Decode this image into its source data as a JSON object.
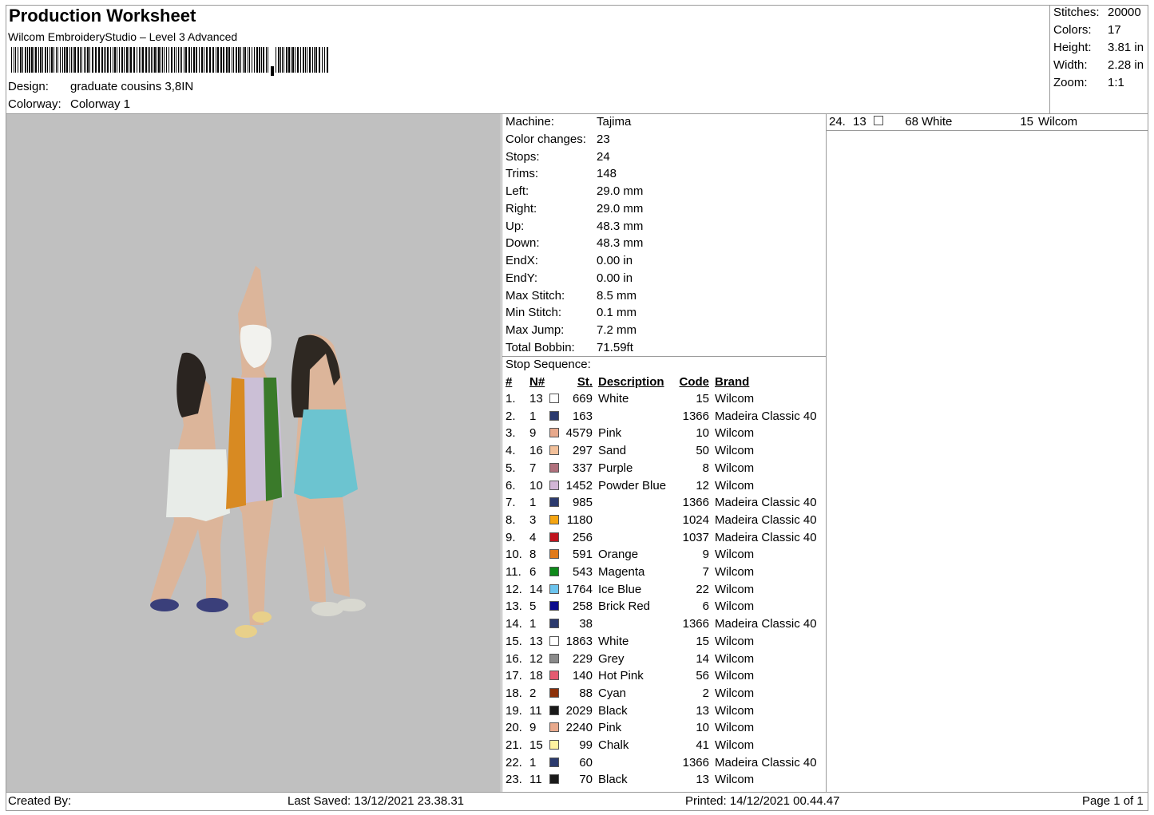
{
  "header": {
    "title": "Production Worksheet",
    "subtitle": "Wilcom EmbroideryStudio – Level 3 Advanced",
    "design_label": "Design:",
    "design_value": "graduate cousins 3,8IN",
    "colorway_label": "Colorway:",
    "colorway_value": "Colorway 1"
  },
  "stats": [
    {
      "label": "Stitches:",
      "value": "20000"
    },
    {
      "label": "Colors:",
      "value": "17"
    },
    {
      "label": "Height:",
      "value": "3.81 in"
    },
    {
      "label": "Width:",
      "value": "2.28 in"
    },
    {
      "label": "Zoom:",
      "value": "1:1"
    }
  ],
  "machine_info": [
    {
      "label": "Machine:",
      "value": "Tajima"
    },
    {
      "label": "Color changes:",
      "value": "23"
    },
    {
      "label": "Stops:",
      "value": "24"
    },
    {
      "label": "Trims:",
      "value": "148"
    },
    {
      "label": "Left:",
      "value": "29.0 mm"
    },
    {
      "label": "Right:",
      "value": "29.0 mm"
    },
    {
      "label": "Up:",
      "value": "48.3 mm"
    },
    {
      "label": "Down:",
      "value": "48.3 mm"
    },
    {
      "label": "EndX:",
      "value": "0.00 in"
    },
    {
      "label": "EndY:",
      "value": "0.00 in"
    },
    {
      "label": "Max Stitch:",
      "value": "8.5 mm"
    },
    {
      "label": "Min Stitch:",
      "value": "0.1 mm"
    },
    {
      "label": "Max Jump:",
      "value": "7.2 mm"
    },
    {
      "label": "Total Bobbin:",
      "value": "71.59ft"
    }
  ],
  "stop_sequence": {
    "title": "Stop Sequence:",
    "headers": {
      "num": "#",
      "n": "N#",
      "st": "St.",
      "desc": "Description",
      "code": "Code",
      "brand": "Brand"
    },
    "rows": [
      {
        "num": "1.",
        "n": "13",
        "color": "#ffffff",
        "st": "669",
        "desc": "White",
        "code": "15",
        "brand": "Wilcom"
      },
      {
        "num": "2.",
        "n": "1",
        "color": "#2b3a6e",
        "st": "163",
        "desc": "",
        "code": "1366",
        "brand": "Madeira Classic 40"
      },
      {
        "num": "3.",
        "n": "9",
        "color": "#e8a98c",
        "st": "4579",
        "desc": "Pink",
        "code": "10",
        "brand": "Wilcom"
      },
      {
        "num": "4.",
        "n": "16",
        "color": "#f2c09a",
        "st": "297",
        "desc": "Sand",
        "code": "50",
        "brand": "Wilcom"
      },
      {
        "num": "5.",
        "n": "7",
        "color": "#b0707c",
        "st": "337",
        "desc": "Purple",
        "code": "8",
        "brand": "Wilcom"
      },
      {
        "num": "6.",
        "n": "10",
        "color": "#d2b6d6",
        "st": "1452",
        "desc": "Powder Blue",
        "code": "12",
        "brand": "Wilcom"
      },
      {
        "num": "7.",
        "n": "1",
        "color": "#2b3a6e",
        "st": "985",
        "desc": "",
        "code": "1366",
        "brand": "Madeira Classic 40"
      },
      {
        "num": "8.",
        "n": "3",
        "color": "#f5a511",
        "st": "1180",
        "desc": "",
        "code": "1024",
        "brand": "Madeira Classic 40"
      },
      {
        "num": "9.",
        "n": "4",
        "color": "#c0141e",
        "st": "256",
        "desc": "",
        "code": "1037",
        "brand": "Madeira Classic 40"
      },
      {
        "num": "10.",
        "n": "8",
        "color": "#e07a1a",
        "st": "591",
        "desc": "Orange",
        "code": "9",
        "brand": "Wilcom"
      },
      {
        "num": "11.",
        "n": "6",
        "color": "#0e8a1a",
        "st": "543",
        "desc": "Magenta",
        "code": "7",
        "brand": "Wilcom"
      },
      {
        "num": "12.",
        "n": "14",
        "color": "#6cc4ee",
        "st": "1764",
        "desc": "Ice Blue",
        "code": "22",
        "brand": "Wilcom"
      },
      {
        "num": "13.",
        "n": "5",
        "color": "#0b0b8c",
        "st": "258",
        "desc": "Brick Red",
        "code": "6",
        "brand": "Wilcom"
      },
      {
        "num": "14.",
        "n": "1",
        "color": "#2b3a6e",
        "st": "38",
        "desc": "",
        "code": "1366",
        "brand": "Madeira Classic 40"
      },
      {
        "num": "15.",
        "n": "13",
        "color": "#ffffff",
        "st": "1863",
        "desc": "White",
        "code": "15",
        "brand": "Wilcom"
      },
      {
        "num": "16.",
        "n": "12",
        "color": "#8a8a8a",
        "st": "229",
        "desc": "Grey",
        "code": "14",
        "brand": "Wilcom"
      },
      {
        "num": "17.",
        "n": "18",
        "color": "#e45a70",
        "st": "140",
        "desc": "Hot Pink",
        "code": "56",
        "brand": "Wilcom"
      },
      {
        "num": "18.",
        "n": "2",
        "color": "#8c3008",
        "st": "88",
        "desc": "Cyan",
        "code": "2",
        "brand": "Wilcom"
      },
      {
        "num": "19.",
        "n": "11",
        "color": "#1a1a1a",
        "st": "2029",
        "desc": "Black",
        "code": "13",
        "brand": "Wilcom"
      },
      {
        "num": "20.",
        "n": "9",
        "color": "#e8a98c",
        "st": "2240",
        "desc": "Pink",
        "code": "10",
        "brand": "Wilcom"
      },
      {
        "num": "21.",
        "n": "15",
        "color": "#fff3a0",
        "st": "99",
        "desc": "Chalk",
        "code": "41",
        "brand": "Wilcom"
      },
      {
        "num": "22.",
        "n": "1",
        "color": "#2b3a6e",
        "st": "60",
        "desc": "",
        "code": "1366",
        "brand": "Madeira Classic 40"
      },
      {
        "num": "23.",
        "n": "11",
        "color": "#1a1a1a",
        "st": "70",
        "desc": "Black",
        "code": "13",
        "brand": "Wilcom"
      }
    ],
    "overflow_row": {
      "num": "24.",
      "n": "13",
      "color": "#ffffff",
      "st": "68",
      "desc": "White",
      "code": "15",
      "brand": "Wilcom"
    }
  },
  "footer": {
    "created_by": "Created By:",
    "last_saved": "Last Saved: 13/12/2021 23.38.31",
    "printed": "Printed: 14/12/2021 00.44.47",
    "page": "Page 1 of 1"
  }
}
